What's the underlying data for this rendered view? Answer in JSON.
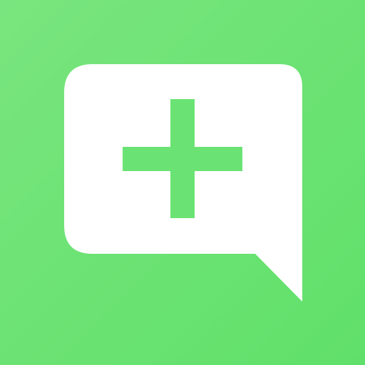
{
  "icon": {
    "semantic_name": "add-message-icon",
    "glyph_bubble": "speech-bubble-icon",
    "glyph_symbol": "plus-icon",
    "colors": {
      "background_start": "#79E57E",
      "background_end": "#60E06A",
      "bubble": "#FFFFFF",
      "plus": "#6BE374"
    }
  }
}
